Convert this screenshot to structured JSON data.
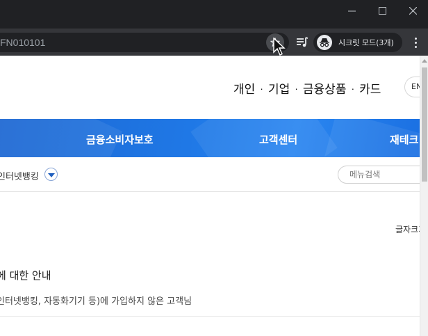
{
  "browser": {
    "url_text": "FN010101",
    "incognito_label": "시크릿 모드(3개)",
    "window_controls": {
      "minimize_icon": "minimize-icon",
      "maximize_icon": "maximize-icon",
      "close_icon": "close-icon"
    }
  },
  "site": {
    "top_nav": [
      "개인",
      "기업",
      "금융상품",
      "카드"
    ],
    "top_nav_separator": "·",
    "lang_button": "EN",
    "gnb": [
      "금융소비자보호",
      "고객센터",
      "재테크"
    ],
    "breadcrumb_title": "인터넷뱅킹",
    "menu_search_placeholder": "메뉴검색",
    "font_size_label": "글자크기",
    "notice_title": "에 대한 안내",
    "notice_desc": "인터넷뱅킹, 자동화기기 등)에 가입하지 않은 고객님"
  },
  "colors": {
    "gnb_blue": "#1f78e6",
    "chrome_dark": "#202124"
  }
}
